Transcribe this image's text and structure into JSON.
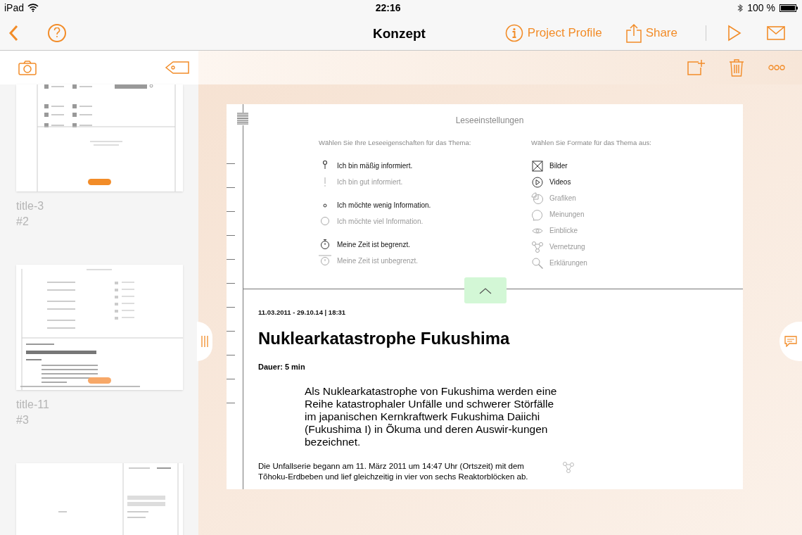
{
  "status_bar": {
    "device": "iPad",
    "time": "22:16",
    "battery": "100 %"
  },
  "nav_bar": {
    "title": "Konzept",
    "actions": [
      {
        "kind": "info",
        "label": "Project Profile"
      },
      {
        "kind": "share",
        "label": "Share"
      }
    ]
  },
  "sidebar": {
    "pages": [
      {
        "kind": "topics",
        "title": "title-3",
        "number": "#2"
      },
      {
        "kind": "reading",
        "title": "title-11",
        "number": "#3"
      },
      {
        "kind": "login"
      }
    ]
  },
  "document": {
    "settings": {
      "title": "Leseeinstellungen",
      "properties_prompt": "Wählen Sie Ihre Leseeigenschaften für das Thema:",
      "property_groups": [
        {
          "options": [
            {
              "kind": "bulb",
              "label": "Ich bin mäßig informiert.",
              "selected": true
            },
            {
              "kind": "exclamation",
              "label": "Ich bin gut informiert.",
              "selected": false
            }
          ]
        },
        {
          "options": [
            {
              "kind": "dot",
              "label": "Ich möchte wenig Information.",
              "selected": true
            },
            {
              "kind": "circle",
              "label": "Ich möchte viel Information.",
              "selected": false
            }
          ]
        },
        {
          "options": [
            {
              "kind": "stopwatch",
              "label": "Meine Zeit ist begrenzt.",
              "selected": true
            },
            {
              "kind": "clock",
              "label": "Meine Zeit ist unbegrenzt.",
              "selected": false
            }
          ]
        }
      ],
      "formats_prompt": "Wählen Sie Formate für das Thema aus:",
      "formats": [
        {
          "kind": "image",
          "label": "Bilder",
          "selected": true
        },
        {
          "kind": "video",
          "label": "Videos",
          "selected": true
        },
        {
          "kind": "chart",
          "label": "Grafiken",
          "selected": false
        },
        {
          "kind": "speech",
          "label": "Meinungen",
          "selected": false
        },
        {
          "kind": "eye",
          "label": "Einblicke",
          "selected": false
        },
        {
          "kind": "network",
          "label": "Vernetzung",
          "selected": false
        },
        {
          "kind": "search",
          "label": "Erklärungen",
          "selected": false
        }
      ]
    },
    "article": {
      "date": "11.03.2011 - 29.10.14 | 18:31",
      "title": "Nuklearkatastrophe Fukushima",
      "duration": "Dauer: 5 min",
      "lead": "Als Nuklearkatastrophe von Fukushima werden eine Reihe katastrophaler Unfälle und schwerer Störfälle im japanischen Kernkraftwerk Fukushima Daiichi (Fukushima I) in Õkuma und deren Auswir-kungen bezeichnet.",
      "body": "Die Unfallserie begann am 11. März 2011 um 14:47 Uhr (Ortszeit) mit dem Tõhoku-Erdbeben und lief gleichzeitig in vier von sechs Reaktorblöcken ab."
    }
  }
}
